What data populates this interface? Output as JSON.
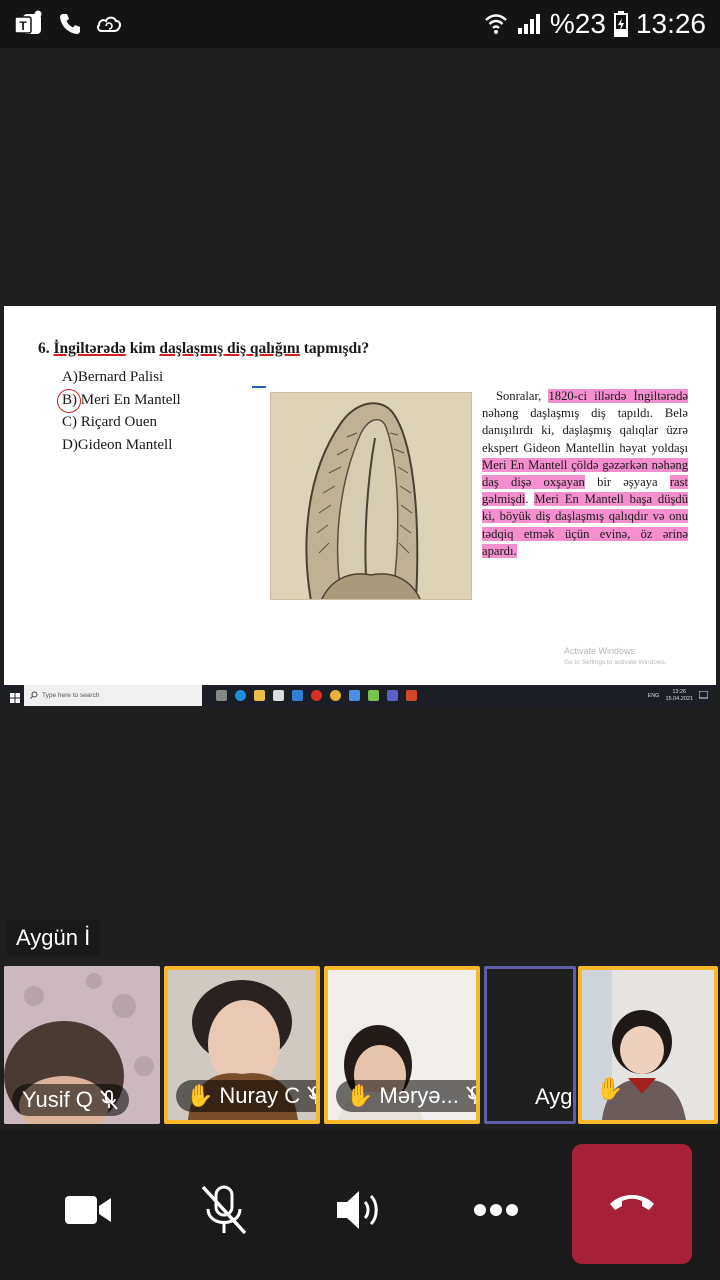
{
  "status_bar": {
    "battery": "%23",
    "time": "13:26",
    "left_icons": [
      "teams-icon",
      "phone-icon",
      "cloud-sync-icon"
    ],
    "right_icons": [
      "wifi-icon",
      "signal-icon",
      "battery-icon"
    ]
  },
  "shared_screen": {
    "question": {
      "number": "6.",
      "part1": "İngiltərədə",
      "part2": " kim ",
      "part3": "daşlaşmış diş qalığını",
      "part4": " tapmışdı?"
    },
    "options": [
      {
        "letter": "A)",
        "text": "Bernard Palisi"
      },
      {
        "letter": "B)",
        "text": "Meri En Mantell",
        "circled": true
      },
      {
        "letter": "C)",
        "text": "Riçard Ouen"
      },
      {
        "letter": "D)",
        "text": "Gideon Mantell"
      }
    ],
    "paragraph": {
      "s1": "Sonralar, ",
      "s2": "1820-ci illərdə İngiltərədə",
      "s3": " nəhəng daşlaşmış diş tapıldı. Belə danışılırdı ki, daşlaşmış qalıqlar üzrə ekspert Gideon Mantellin həyat yoldaşı ",
      "s4": "Meri En Mantell çöldə gəzərkən nəhəng daş dişə oxşayan",
      "s5": " bir əşyaya ",
      "s6": "rast gəlmişdi",
      "s7": ". ",
      "s8": "Meri En Mantell başa düşdü ki, böyük diş daşlaşmış qalıqdır və onu tədqiq etmək üçün evinə, öz ərinə apardı."
    },
    "watermark": {
      "line1": "Activate Windows",
      "line2": "Go to Settings to activate Windows."
    },
    "taskbar": {
      "search_placeholder": "Type here to search",
      "lang": "ENG",
      "time": "13:26",
      "date": "15.04.2021"
    }
  },
  "speaker_label": "Aygün İ",
  "participants": [
    {
      "name": "Yusif Q",
      "hand_raised": false,
      "muted": true
    },
    {
      "name": "Nuray C",
      "hand_raised": true,
      "muted": true
    },
    {
      "name": "Məryə...",
      "hand_raised": true,
      "muted": true
    },
    {
      "name": "Aygü",
      "hand_raised": false,
      "muted": false
    },
    {
      "name": "",
      "hand_raised": true,
      "muted": false
    }
  ],
  "controls": [
    "video-camera-icon",
    "mic-muted-icon",
    "speaker-icon",
    "more-options-icon",
    "hang-up-icon"
  ],
  "colors": {
    "raised_hand_border": "#f7b92a",
    "hangup": "#a6203a",
    "highlight": "#f48fcd",
    "underline": "#d42020"
  }
}
